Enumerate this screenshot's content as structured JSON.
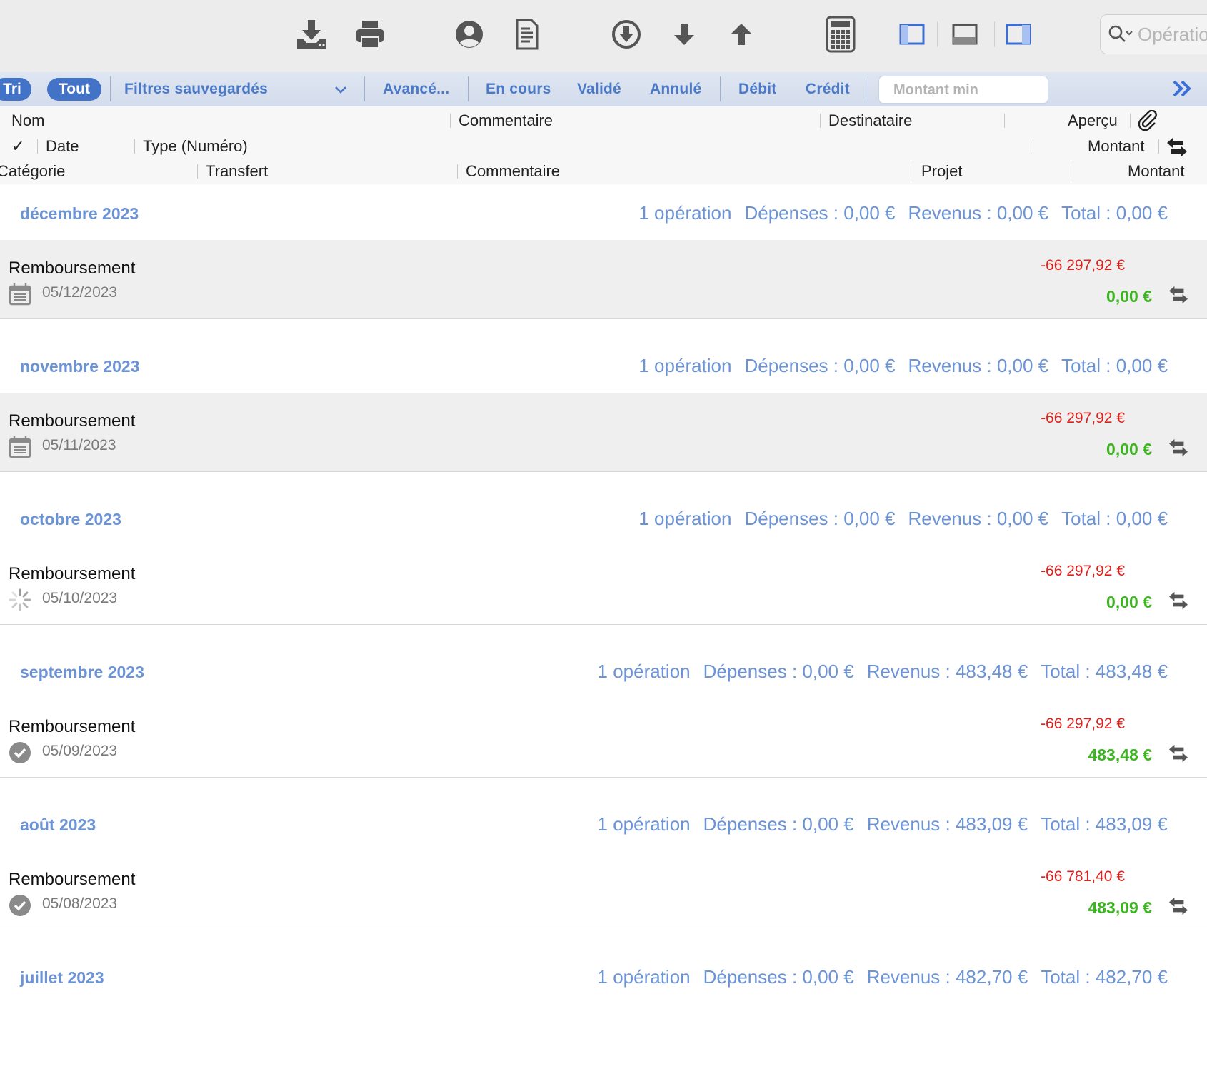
{
  "toolbar": {
    "search_placeholder": "Opératio",
    "icons": [
      "download-icon",
      "print-icon",
      "account-icon",
      "document-icon",
      "circle-download-icon",
      "arrow-down-icon",
      "arrow-up-icon",
      "calculator-icon",
      "sidebar-left-icon",
      "panel-bottom-icon",
      "sidebar-right-icon",
      "search-icon"
    ]
  },
  "filterbar": {
    "tri": "Tri",
    "tout": "Tout",
    "saved_filters": "Filtres sauvegardés",
    "advanced": "Avancé...",
    "pending": "En cours",
    "validated": "Validé",
    "cancelled": "Annulé",
    "debit": "Débit",
    "credit": "Crédit",
    "min_amount_placeholder": "Montant min"
  },
  "columns": {
    "row1": {
      "nom": "Nom",
      "commentaire": "Commentaire",
      "destinataire": "Destinataire",
      "apercu": "Aperçu"
    },
    "row2": {
      "check": "✓",
      "date": "Date",
      "type": "Type (Numéro)",
      "montant": "Montant"
    },
    "row3": {
      "categorie": "Catégorie",
      "transfert": "Transfert",
      "commentaire": "Commentaire",
      "projet": "Projet",
      "montant": "Montant"
    }
  },
  "months": [
    {
      "name": "décembre 2023",
      "count": "1 opération",
      "depenses": "Dépenses : 0,00 €",
      "revenus": "Revenus : 0,00 €",
      "total": "Total : 0,00 €",
      "row": {
        "name": "Remboursement",
        "date": "05/12/2023",
        "status": "scheduled",
        "amount": "-66 297,92 €",
        "balance": "0,00 €",
        "shaded": true,
        "divider": false
      }
    },
    {
      "name": "novembre 2023",
      "count": "1 opération",
      "depenses": "Dépenses : 0,00 €",
      "revenus": "Revenus : 0,00 €",
      "total": "Total : 0,00 €",
      "row": {
        "name": "Remboursement",
        "date": "05/11/2023",
        "status": "scheduled",
        "amount": "-66 297,92 €",
        "balance": "0,00 €",
        "shaded": true,
        "divider": false
      }
    },
    {
      "name": "octobre 2023",
      "count": "1 opération",
      "depenses": "Dépenses : 0,00 €",
      "revenus": "Revenus : 0,00 €",
      "total": "Total : 0,00 €",
      "row": {
        "name": "Remboursement",
        "date": "05/10/2023",
        "status": "pending",
        "amount": "-66 297,92 €",
        "balance": "0,00 €",
        "shaded": false,
        "divider": true
      }
    },
    {
      "name": "septembre 2023",
      "count": "1 opération",
      "depenses": "Dépenses : 0,00 €",
      "revenus": "Revenus : 483,48 €",
      "total": "Total : 483,48 €",
      "row": {
        "name": "Remboursement",
        "date": "05/09/2023",
        "status": "validated",
        "amount": "-66 297,92 €",
        "balance": "483,48 €",
        "shaded": false,
        "divider": true
      }
    },
    {
      "name": "août 2023",
      "count": "1 opération",
      "depenses": "Dépenses : 0,00 €",
      "revenus": "Revenus : 483,09 €",
      "total": "Total : 483,09 €",
      "row": {
        "name": "Remboursement",
        "date": "05/08/2023",
        "status": "validated",
        "amount": "-66 781,40 €",
        "balance": "483,09 €",
        "shaded": false,
        "divider": true
      }
    },
    {
      "name": "juillet 2023",
      "count": "1 opération",
      "depenses": "Dépenses : 0,00 €",
      "revenus": "Revenus : 482,70 €",
      "total": "Total : 482,70 €",
      "row": null
    }
  ],
  "colors": {
    "accent": "#4a79c7",
    "month": "#6b93d6",
    "negative": "#e0201b",
    "positive": "#3cb521"
  }
}
